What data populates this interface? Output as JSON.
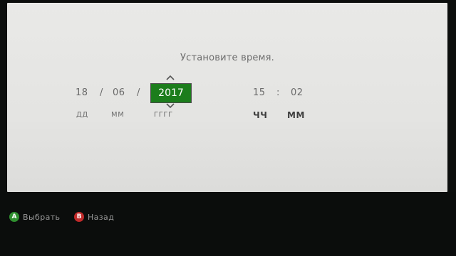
{
  "title": "Установите время.",
  "date": {
    "day": "18",
    "month": "06",
    "year": "2017",
    "separator": "/",
    "labels": {
      "day": "ДД",
      "month": "ММ",
      "year": "ГГГГ"
    }
  },
  "time": {
    "hours": "15",
    "minutes": "02",
    "separator": ":",
    "labels": {
      "hours": "ЧЧ",
      "minutes": "ММ"
    }
  },
  "footer": {
    "select": {
      "key": "A",
      "label": "Выбрать",
      "color": "#2f8f2f"
    },
    "back": {
      "key": "B",
      "label": "Назад",
      "color": "#c02a2a"
    }
  }
}
